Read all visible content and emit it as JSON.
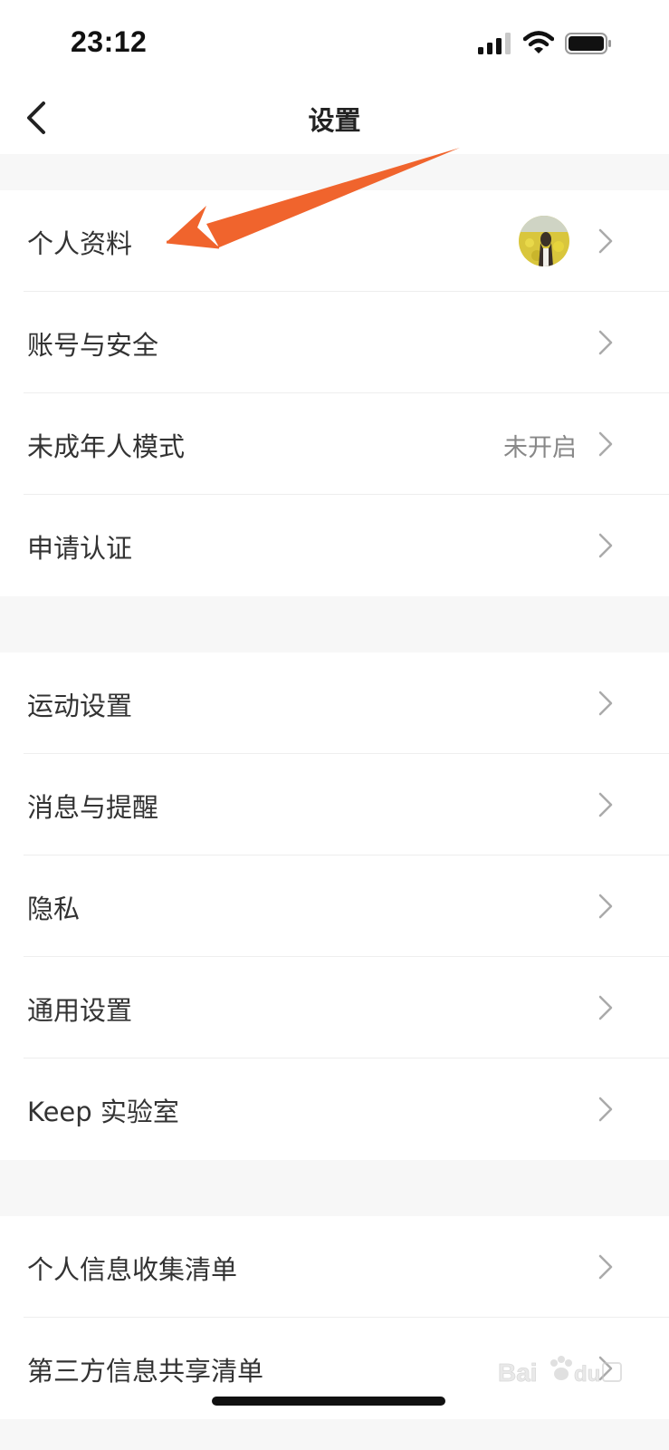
{
  "status_bar": {
    "time": "23:12",
    "icons": [
      "signal-icon",
      "wifi-icon",
      "battery-icon"
    ]
  },
  "nav": {
    "title": "设置",
    "back_icon": "back-chevron-icon"
  },
  "groups": [
    {
      "items": [
        {
          "label": "个人资料",
          "has_avatar": true
        },
        {
          "label": "账号与安全"
        },
        {
          "label": "未成年人模式",
          "value": "未开启"
        },
        {
          "label": "申请认证"
        }
      ]
    },
    {
      "items": [
        {
          "label": "运动设置"
        },
        {
          "label": "消息与提醒"
        },
        {
          "label": "隐私"
        },
        {
          "label": "通用设置"
        },
        {
          "label": "Keep 实验室"
        }
      ]
    },
    {
      "items": [
        {
          "label": "个人信息收集清单"
        },
        {
          "label": "第三方信息共享清单"
        }
      ]
    }
  ],
  "annotation": {
    "color": "#f0642d",
    "points_to": "个人资料"
  },
  "colors": {
    "background": "#f7f7f7",
    "row_background": "#ffffff",
    "text": "#333333",
    "secondary_text": "#888888",
    "chevron": "#aaaaaa"
  }
}
